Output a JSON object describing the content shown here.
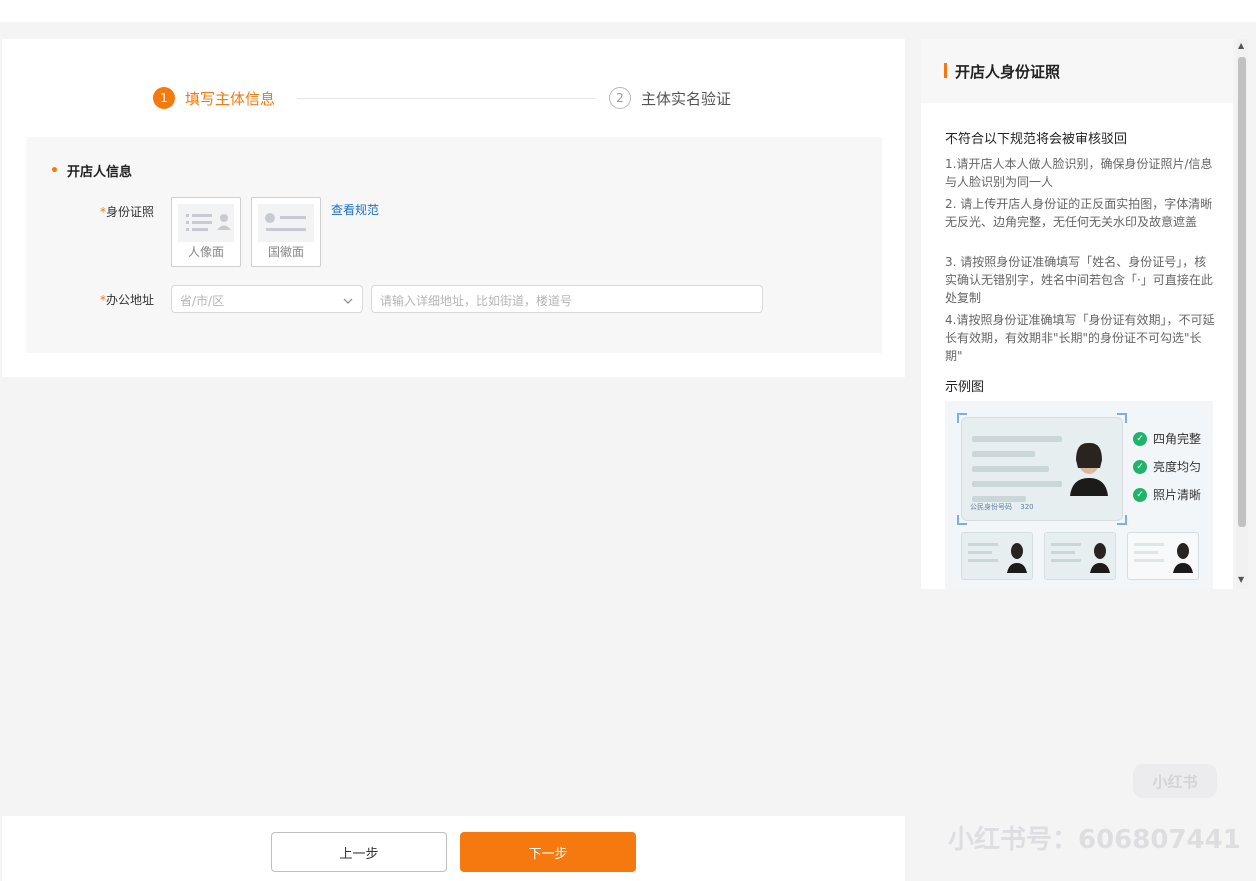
{
  "steps": [
    {
      "number": "1",
      "label": "填写主体信息"
    },
    {
      "number": "2",
      "label": "主体实名验证"
    }
  ],
  "form": {
    "section_title": "开店人信息",
    "required_mark": "*",
    "id_label": "身份证照",
    "upload_portrait": "人像面",
    "upload_emblem": "国徽面",
    "view_spec_link": "查看规范",
    "address_label": "办公地址",
    "region_placeholder": "省/市/区",
    "detail_placeholder": "请输入详细地址，比如街道，楼道号"
  },
  "footer": {
    "prev_label": "上一步",
    "next_label": "下一步"
  },
  "side": {
    "title": "开店人身份证照",
    "subtitle": "不符合以下规范将会被审核驳回",
    "rules": [
      "1.请开店人本人做人脸识别，确保身份证照片/信息与人脸识别为同一人",
      "2. 请上传开店人身份证的正反面实拍图，字体清晰无反光、边角完整，无任何无关水印及故意遮盖",
      "3. 请按照身份证准确填写「姓名、身份证号」，核实确认无错别字，姓名中间若包含「·」可直接在此处复制",
      "4.请按照身份证准确填写「身份证有效期」，不可延长有效期，有效期非\"长期\"的身份证不可勾选\"长期\""
    ],
    "example_title": "示例图",
    "checks": [
      "四角完整",
      "亮度均匀",
      "照片清晰"
    ],
    "id_number_label": "公民身份号码",
    "id_number_prefix": "320"
  },
  "brand": {
    "logo_text": "小红书",
    "account_text": "小红书号：606807441"
  },
  "colors": {
    "accent": "#f5790f",
    "link": "#1b6fc9",
    "check": "#21b36c"
  }
}
